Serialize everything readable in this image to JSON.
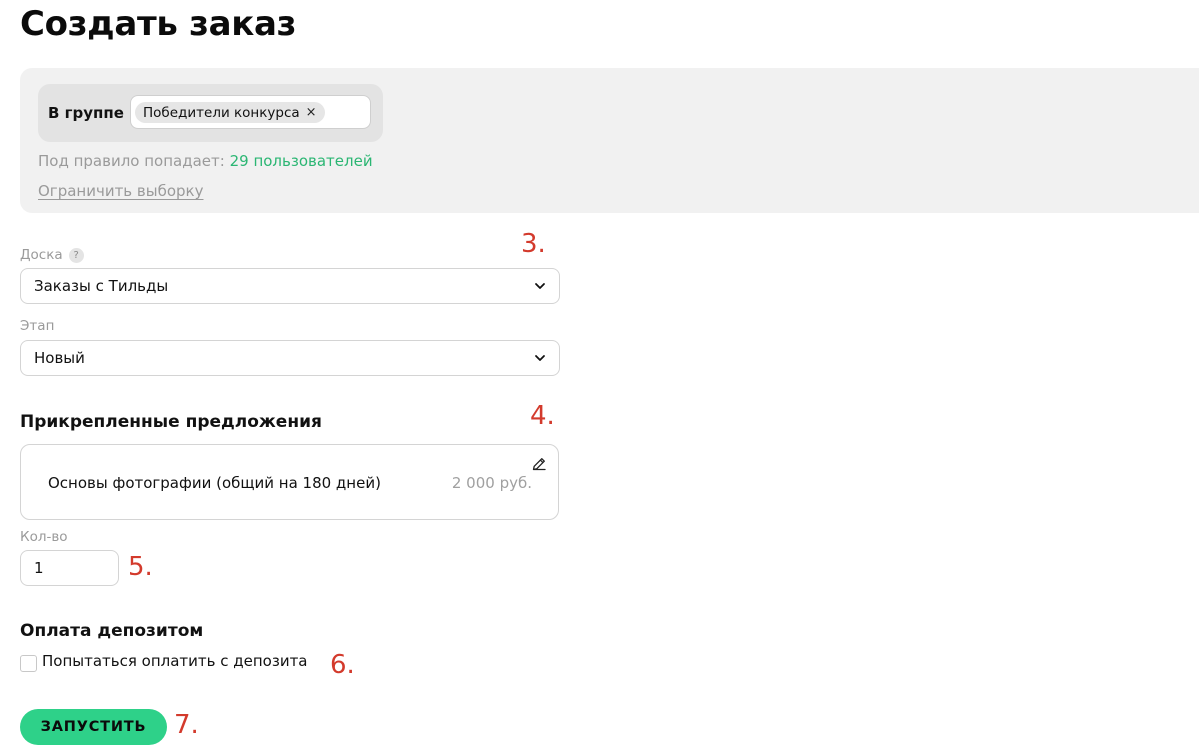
{
  "page": {
    "title": "Создать заказ"
  },
  "rule": {
    "group_label": "В группе",
    "group_chip": "Победители конкурса",
    "chip_close": "×",
    "match_prefix": "Под правило попадает:",
    "match_count": "29 пользователей",
    "limit_link": "Ограничить выборку"
  },
  "board": {
    "label": "Доска",
    "help": "?",
    "value": "Заказы с Тильды"
  },
  "stage": {
    "label": "Этап",
    "value": "Новый"
  },
  "offers": {
    "heading": "Прикрепленные предложения",
    "items": [
      {
        "name": "Основы фотографии (общий на 180 дней)",
        "price": "2 000 руб."
      }
    ]
  },
  "quantity": {
    "label": "Кол-во",
    "value": "1"
  },
  "deposit": {
    "heading": "Оплата депозитом",
    "checkbox_label": "Попытаться оплатить с депозита",
    "checked": false
  },
  "actions": {
    "run_label": "ЗАПУСТИТЬ"
  },
  "annotations": {
    "a3": "3.",
    "a4": "4.",
    "a5": "5.",
    "a6": "6.",
    "a7": "7."
  },
  "colors": {
    "accent_green": "#2ed189",
    "link_green": "#2bb673",
    "annotation_red": "#d33a2c",
    "muted_text": "#9a9a9a",
    "panel_bg": "#f1f1f1"
  },
  "icons": {
    "chevron": "chevron-down-icon",
    "edit": "pencil-icon",
    "help": "question-icon",
    "close": "close-icon"
  }
}
